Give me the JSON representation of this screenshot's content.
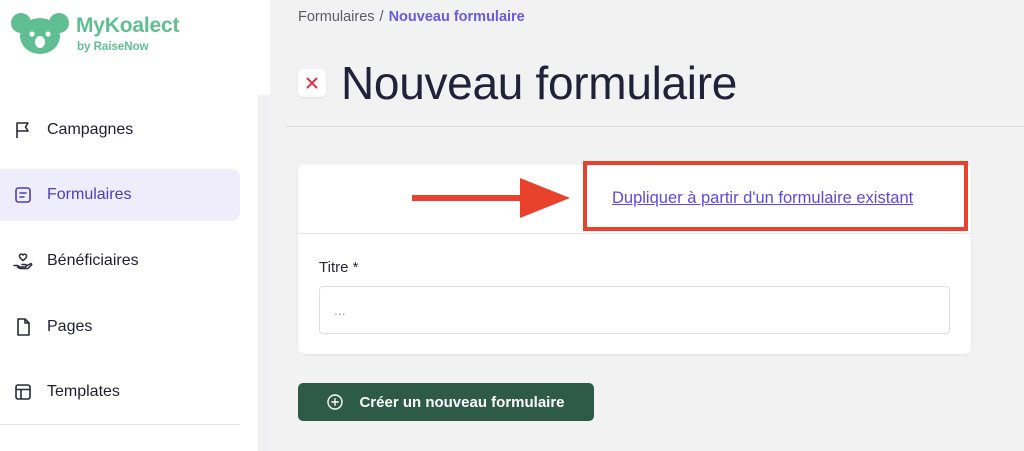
{
  "brand": {
    "title": "MyKoalect",
    "subtitle": "by RaiseNow",
    "color": "#5fbf93"
  },
  "sidebar": {
    "items": [
      {
        "label": "Campagnes",
        "icon": "flag-icon",
        "active": false
      },
      {
        "label": "Formulaires",
        "icon": "form-icon",
        "active": true
      },
      {
        "label": "Bénéficiaires",
        "icon": "hand-heart-icon",
        "active": false
      },
      {
        "label": "Pages",
        "icon": "page-icon",
        "active": false
      },
      {
        "label": "Templates",
        "icon": "layout-icon",
        "active": false
      }
    ]
  },
  "breadcrumb": {
    "parent": "Formulaires",
    "separator": "/",
    "current": "Nouveau formulaire"
  },
  "page": {
    "title": "Nouveau formulaire"
  },
  "form": {
    "duplicate_link": "Dupliquer à partir d'un formulaire existant",
    "title_label": "Titre *",
    "title_placeholder": "...",
    "title_value": ""
  },
  "actions": {
    "create_label": "Créer un nouveau formulaire"
  },
  "colors": {
    "accent": "#6a5ae0",
    "primary_button": "#2e5a48",
    "annotation_red": "#e8422d",
    "close_icon": "#e0354a"
  }
}
